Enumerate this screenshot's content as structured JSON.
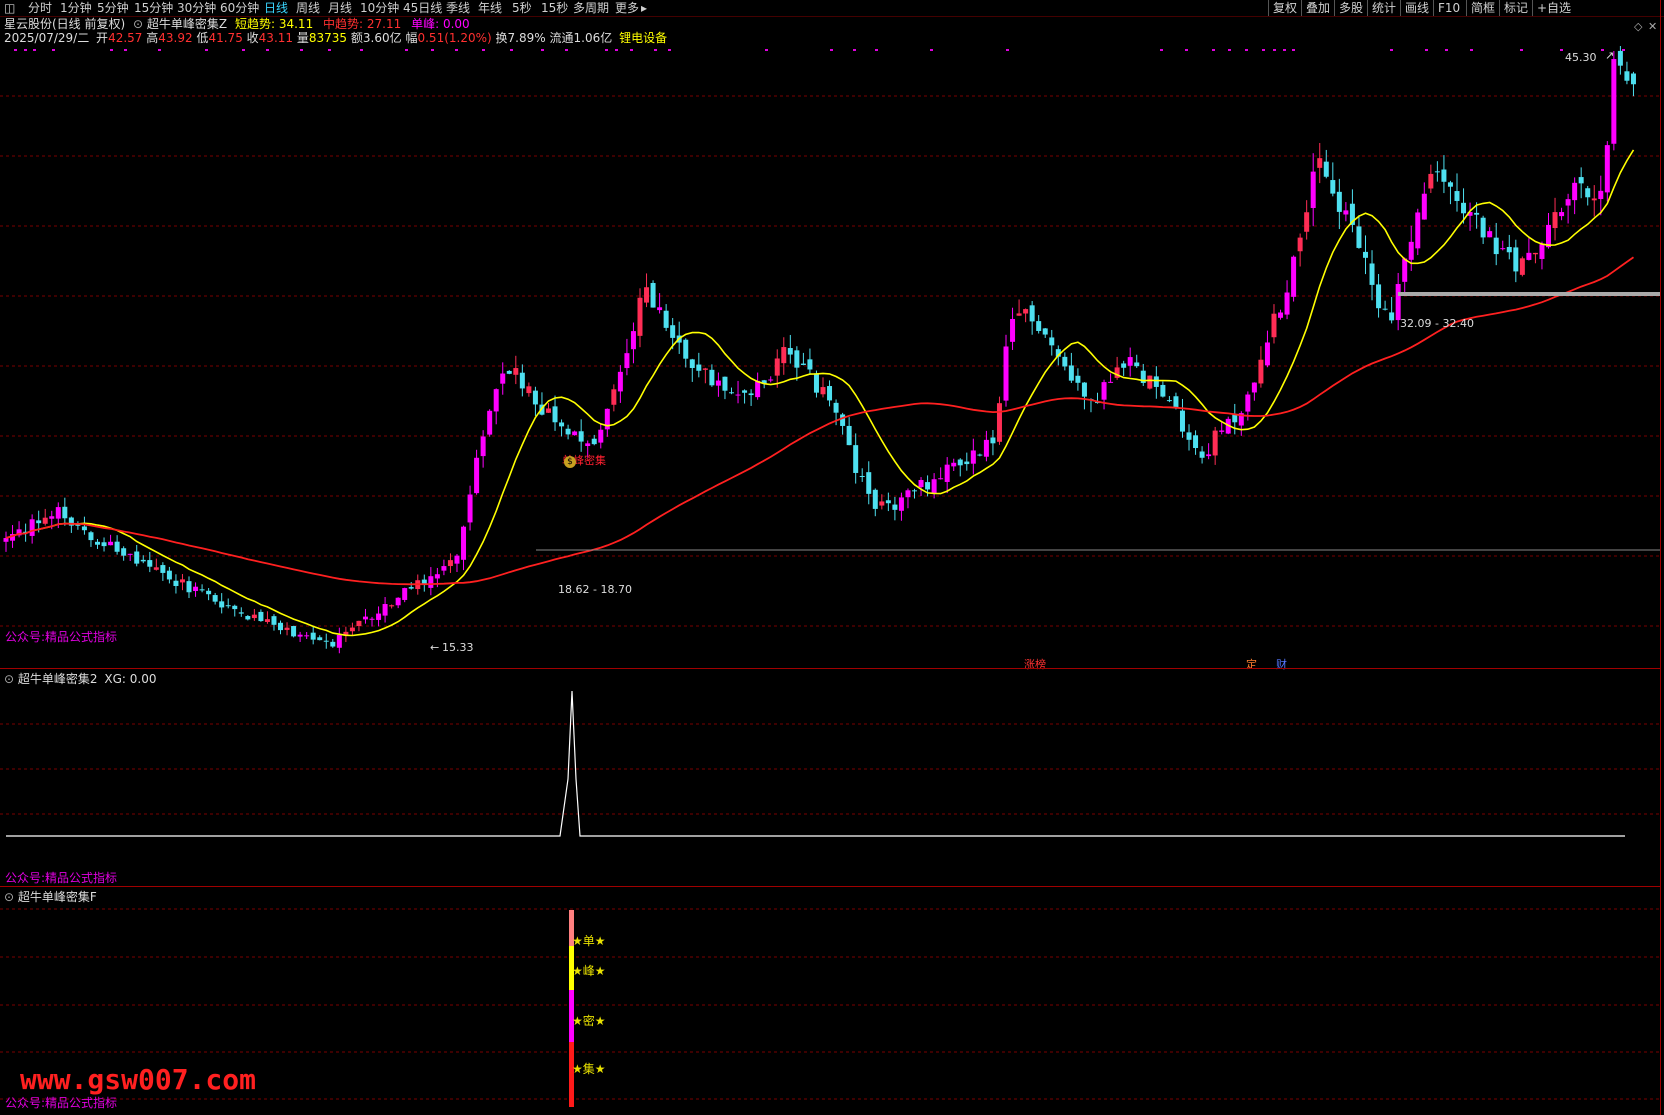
{
  "toolbar": {
    "period_tabs": [
      "分时",
      "1分钟",
      "5分钟",
      "15分钟",
      "30分钟",
      "60分钟",
      "日线",
      "周线",
      "月线",
      "10分钟",
      "45日线",
      "季线",
      "年线",
      "5秒",
      "15秒",
      "多周期",
      "更多"
    ],
    "active_tab": "日线",
    "right_buttons": [
      "复权",
      "叠加",
      "多股",
      "统计",
      "画线",
      "F10",
      "简框",
      "标记",
      "+自选"
    ]
  },
  "header": {
    "stock_name": "星云股份(日线 前复权)",
    "indicator_name": "超牛单峰密集Z",
    "short_trend_label": "短趋势:",
    "short_trend_value": "34.11",
    "mid_trend_label": "中趋势:",
    "mid_trend_value": "27.11",
    "single_peak_label": "单峰:",
    "single_peak_value": "0.00",
    "date": "2025/07/29/二",
    "open_label": "开",
    "open": "42.57",
    "high_label": "高",
    "high": "43.92",
    "low_label": "低",
    "low": "41.75",
    "close_label": "收",
    "close": "43.11",
    "volume_label": "量",
    "volume": "83735",
    "amount_label": "额",
    "amount": "3.60亿",
    "change_label": "幅",
    "change": "0.51(1.20%)",
    "turnover_label": "换",
    "turnover": "7.89%",
    "float_label": "流通",
    "float": "1.06亿",
    "sector": "锂电设备"
  },
  "main_chart": {
    "price_max_label": "45.30",
    "price_min_label": "15.33",
    "range_low_label": "18.62 - 18.70",
    "range_high_label": "32.09 - 32.40",
    "signal_label": "单峰密集",
    "watermark": "公众号:精品公式指标",
    "event_tags": [
      "涨榜",
      "定",
      "财"
    ]
  },
  "pane2": {
    "title": "超牛单峰密集2",
    "xg_label": "XG:",
    "xg_value": "0.00",
    "watermark": "公众号:精品公式指标"
  },
  "pane3": {
    "title": "超牛单峰密集F",
    "markers": [
      "★单★",
      "★峰★",
      "★密★",
      "★集★"
    ],
    "watermark": "公众号:精品公式指标",
    "site": "www.gsw007.com"
  },
  "colors": {
    "up": "#ff2d55",
    "up_bull": "#ff00ff",
    "down": "#4ee0f0",
    "ma_short": "#ffff00",
    "ma_long": "#ff2020",
    "grid": "#7a0000"
  },
  "chart_data": {
    "type": "candlestick",
    "y_range": [
      15.33,
      45.3
    ],
    "price_path": [
      20.5,
      21.0,
      21.6,
      22.0,
      21.4,
      20.8,
      20.2,
      19.6,
      19.2,
      18.9,
      18.4,
      18.0,
      17.5,
      17.1,
      16.7,
      16.3,
      16.0,
      15.7,
      15.5,
      15.33,
      15.9,
      16.6,
      17.2,
      17.8,
      18.4,
      19.0,
      19.7,
      23.5,
      27.8,
      29.3,
      28.4,
      27.2,
      26.6,
      26.0,
      25.5,
      27.6,
      30.5,
      33.4,
      31.6,
      30.2,
      29.1,
      28.8,
      28.4,
      27.9,
      28.6,
      30.1,
      29.3,
      28.1,
      27.0,
      24.2,
      22.6,
      22.0,
      22.8,
      23.3,
      23.9,
      24.3,
      24.9,
      25.6,
      31.2,
      32.4,
      31.1,
      29.4,
      28.3,
      27.9,
      29.2,
      29.6,
      28.7,
      27.6,
      26.4,
      24.8,
      25.8,
      26.7,
      27.9,
      31.4,
      33.2,
      37.5,
      39.6,
      37.1,
      36.2,
      33.0,
      32.09,
      35.2,
      38.4,
      38.9,
      37.7,
      36.6,
      35.3,
      34.5,
      34.7,
      36.1,
      37.4,
      38.6,
      37.2,
      45.3,
      43.11
    ]
  }
}
